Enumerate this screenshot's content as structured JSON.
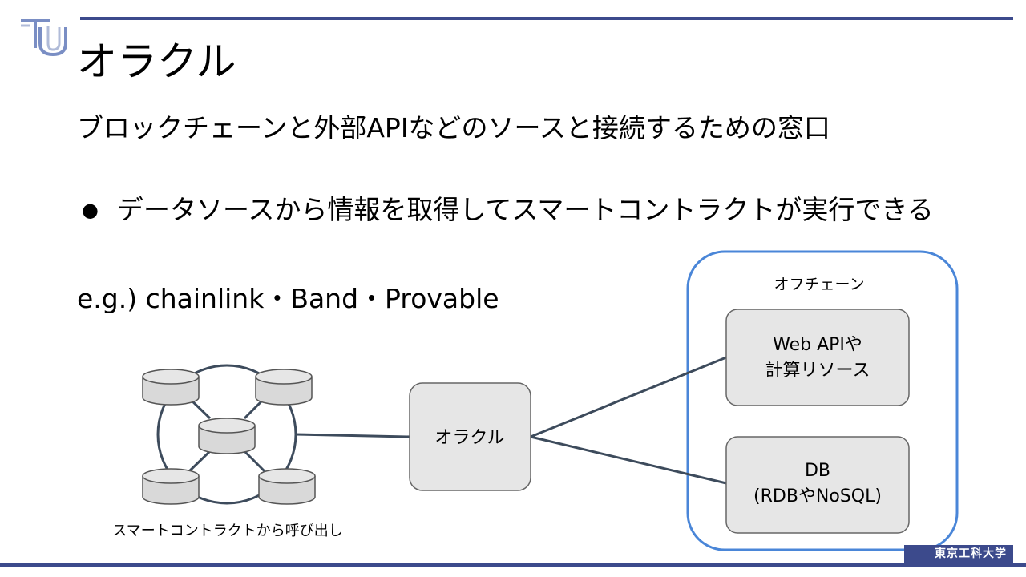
{
  "slide": {
    "title": "オラクル",
    "lead": "ブロックチェーンと外部APIなどのソースと接続するための窓口",
    "bullets": [
      {
        "text": "データソースから情報を取得してスマートコントラクトが実行できる"
      }
    ],
    "example": "e.g.) chainlink・Band・Provable"
  },
  "diagram": {
    "network_caption": "スマートコントラクトから呼び出し",
    "oracle_label": "オラクル",
    "offchain_label": "オフチェーン",
    "web_api_line1": "Web APIや",
    "web_api_line2": "計算リソース",
    "db_line1": "DB",
    "db_line2": "(RDBやNoSQL)"
  },
  "footer": {
    "university": "東京工科大学"
  },
  "colors": {
    "accent_bar": "#3c4a8c",
    "offchain_border": "#4a86d8",
    "node_fill": "#e6e6e6",
    "connector": "#3d4b5c"
  },
  "icons": {
    "logo": "university-logo-icon",
    "database": "database-cylinder-icon"
  }
}
